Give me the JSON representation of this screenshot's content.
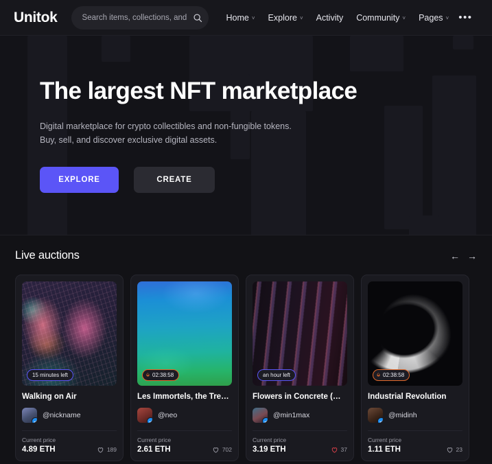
{
  "header": {
    "logo": "Unitok",
    "search": {
      "placeholder": "Search items, collections, and",
      "value": "",
      "icon": "search-icon"
    },
    "nav": [
      {
        "label": "Home",
        "caret": "˅"
      },
      {
        "label": "Explore",
        "caret": "˅"
      },
      {
        "label": "Activity",
        "caret": ""
      },
      {
        "label": "Community",
        "caret": "˅"
      },
      {
        "label": "Pages",
        "caret": "˅"
      }
    ],
    "more_label": "•••"
  },
  "hero": {
    "title": "The largest NFT marketplace",
    "sub_line1": "Digital marketplace for crypto collectibles and non-fungible tokens.",
    "sub_line2": "Buy, sell, and discover exclusive digital assets.",
    "cta_primary": "EXPLORE",
    "cta_secondary": "CREATE",
    "accent": "#5b55f7"
  },
  "auctions": {
    "section_title": "Live auctions",
    "arrow_prev": "←",
    "arrow_next": "→",
    "price_label": "Current price",
    "cards": [
      {
        "title": "Walking on Air",
        "owner": "@nickname",
        "badge": "15 minutes left",
        "badge_style": "purple",
        "flame": "",
        "price": "4.89 ETH",
        "likes": "189",
        "liked": false
      },
      {
        "title": "Les Immortels, the Treacher…",
        "owner": "@neo",
        "badge": "02:38:58",
        "badge_style": "orange",
        "flame": "🔥",
        "price": "2.61 ETH",
        "likes": "702",
        "liked": false
      },
      {
        "title": "Flowers in Concrete (Modal)",
        "owner": "@min1max",
        "badge": "an hour left",
        "badge_style": "purple",
        "flame": "",
        "price": "3.19 ETH",
        "likes": "37",
        "liked": true
      },
      {
        "title": "Industrial Revolution",
        "owner": "@midinh",
        "badge": "02:38:58",
        "badge_style": "orange",
        "flame": "🔥",
        "price": "1.11 ETH",
        "likes": "23",
        "liked": false
      }
    ]
  },
  "colors": {
    "page_bg": "#121216",
    "card_bg": "#1a1a20",
    "accent_purple": "#5b55f7",
    "accent_orange": "#e2692b",
    "verified_blue": "#1d8ef2",
    "like_red": "#e0414b"
  }
}
